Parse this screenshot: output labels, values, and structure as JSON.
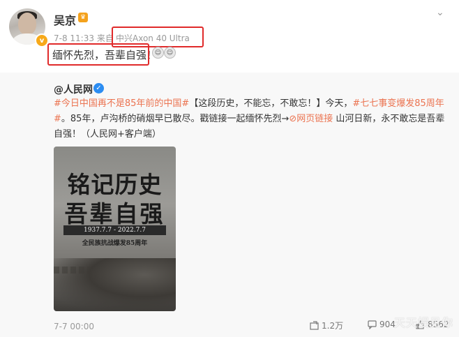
{
  "post": {
    "username": "吴京",
    "time": "7-8 11:33",
    "source_prefix": "来自",
    "device": "中兴Axon 40 Ultra",
    "text": "缅怀先烈，吾辈自强",
    "text_suffix": "！"
  },
  "repost": {
    "username": "@人民网",
    "hashtag1": "#今日中国再不是85年前的中国#",
    "text1": "【这段历史，不能忘，不敢忘！】今天，",
    "hashtag2": "#七七事变爆发85周年#",
    "text2": "。85年，卢沟桥的硝烟早已散尽。戳链接一起缅怀先烈→",
    "link_label": "网页链接",
    "text3": " 山河日新，永不敢忘是吾辈自强！（人民网+客户端）",
    "poster": {
      "line1": "铭记历史",
      "line2": "吾辈自强",
      "dates": "1937.7.7 - 2022.7.7",
      "subtitle": "全民族抗战爆发85周年"
    },
    "date": "7-7 00:00",
    "shares": "1.2万",
    "comments": "904",
    "likes": "8562"
  },
  "watermark": "天天娱见你"
}
